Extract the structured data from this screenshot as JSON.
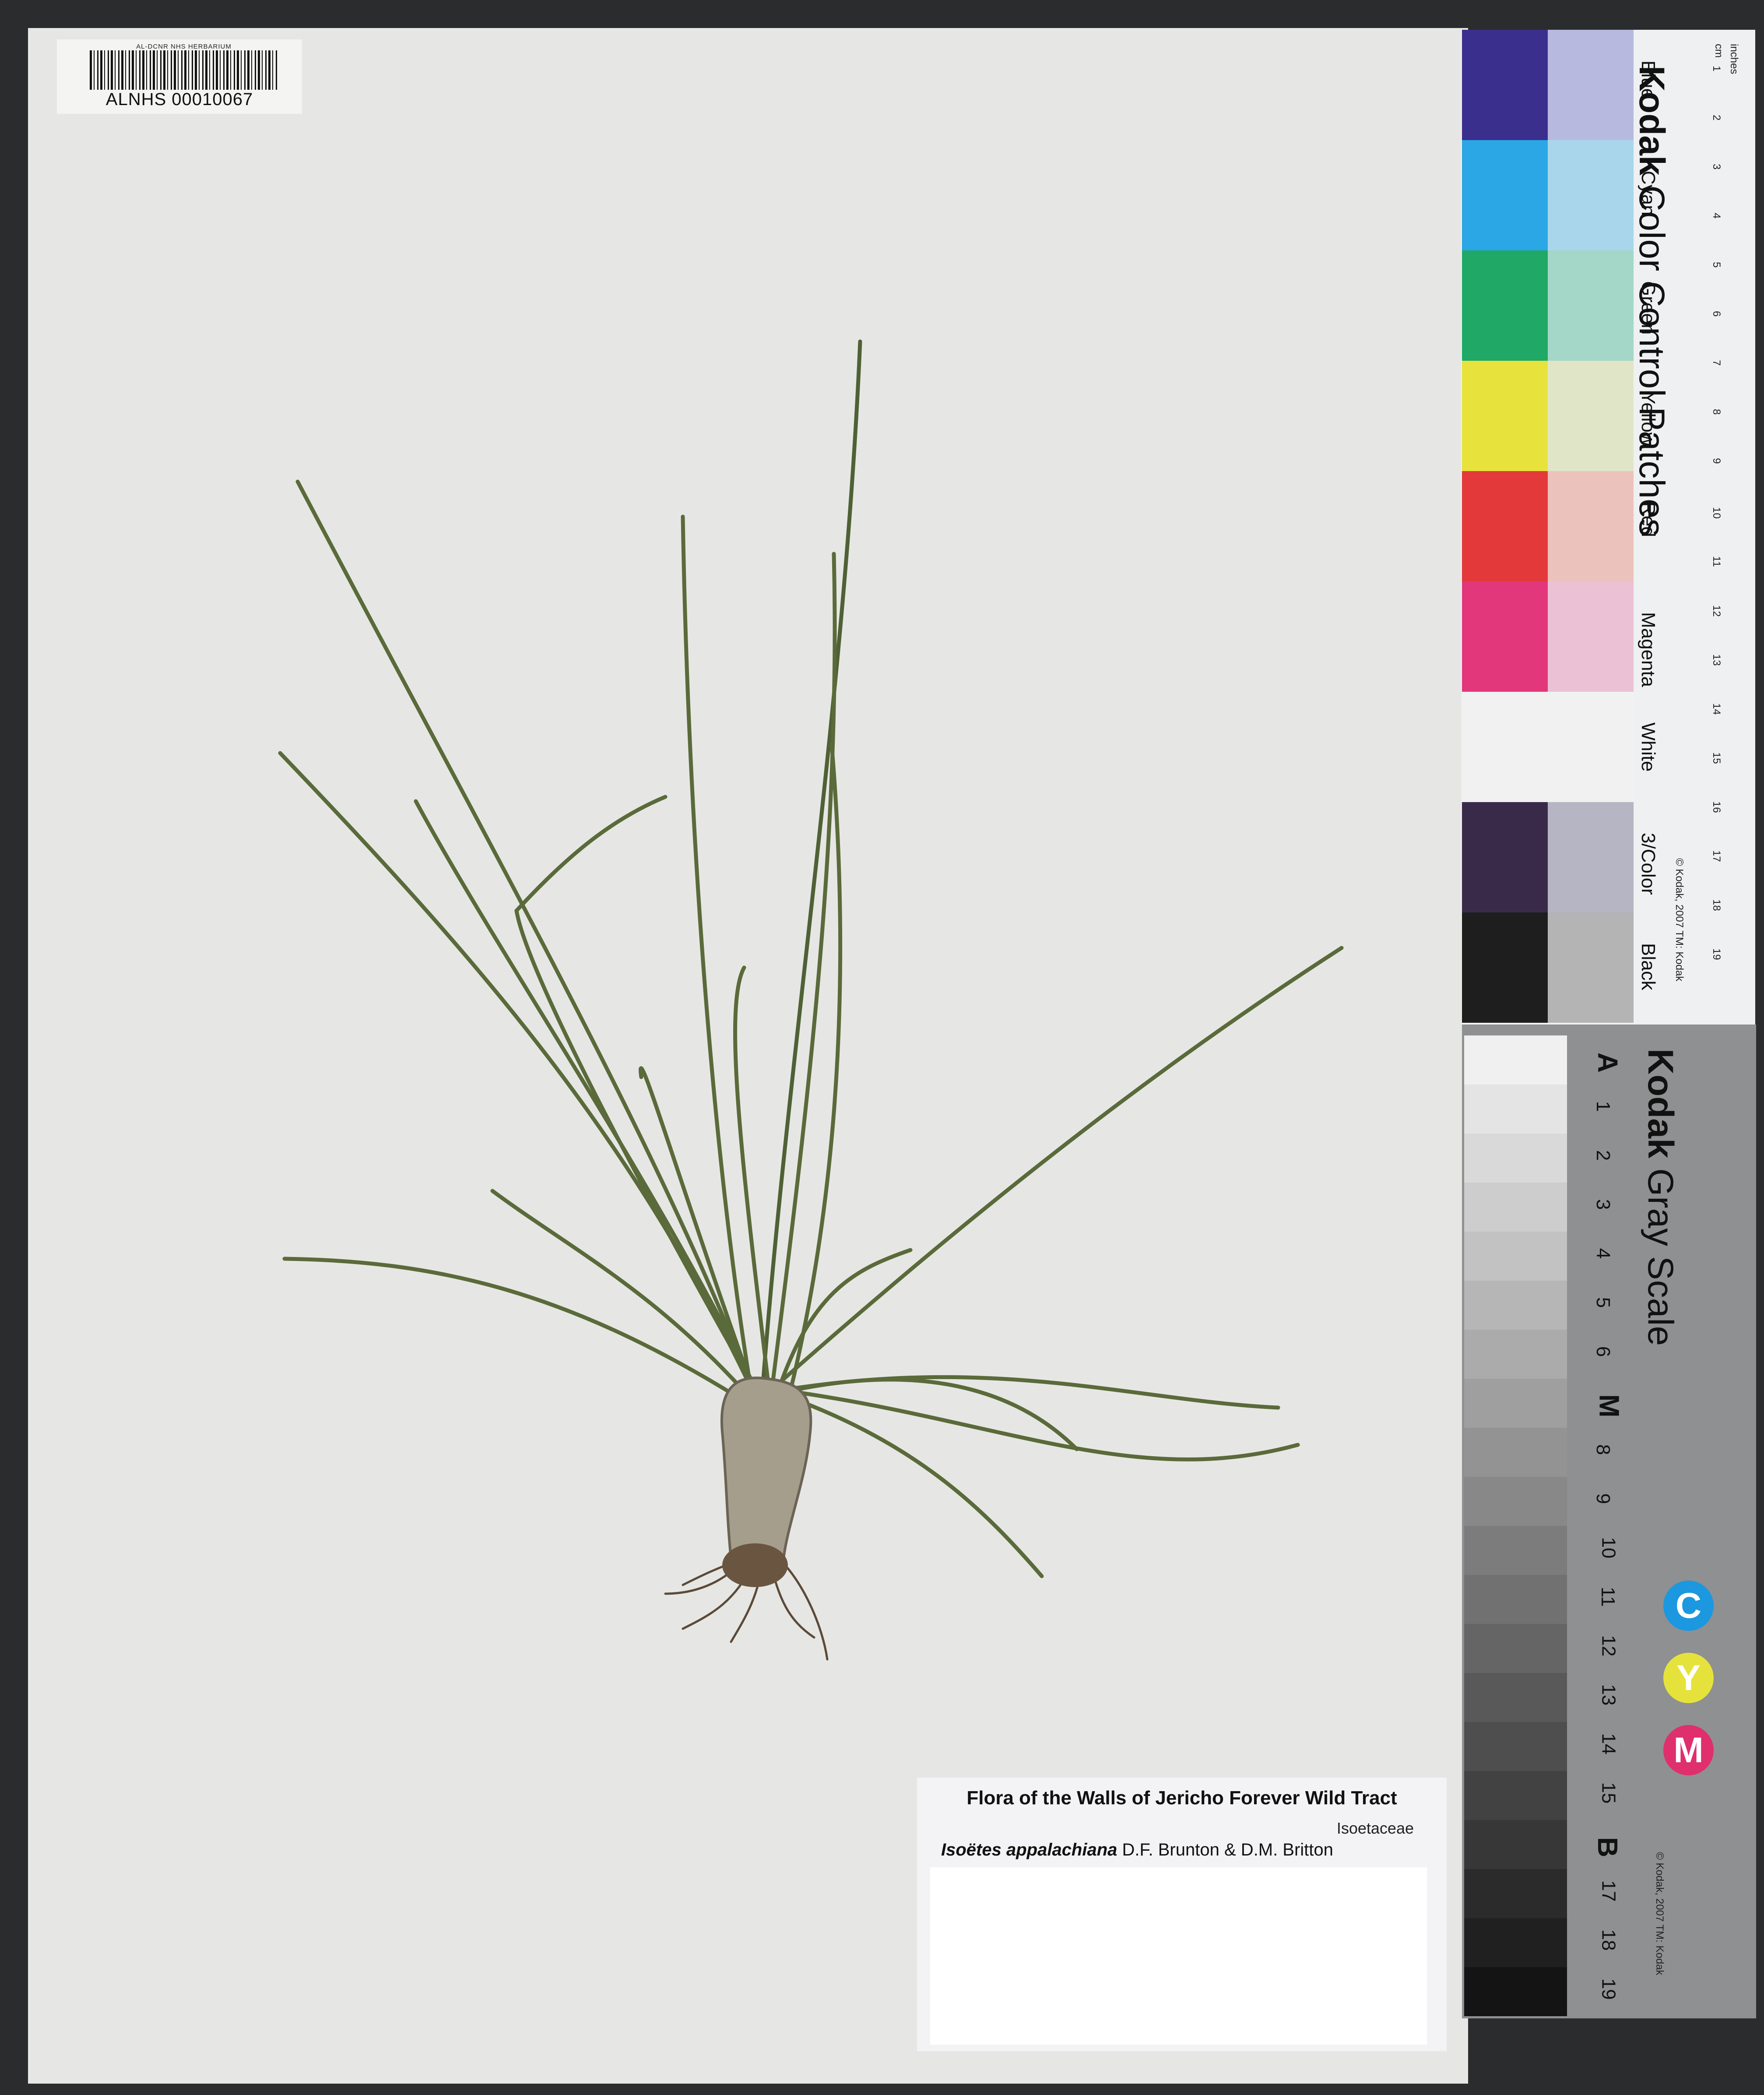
{
  "barcode": {
    "herbarium": "AL-DCNR NHS HERBARIUM",
    "catalog_number": "ALNHS 00010067"
  },
  "label": {
    "title": "Flora of the Walls of Jericho Forever Wild Tract",
    "family": "Isoetaceae",
    "genus_species": "Isoëtes appalachiana",
    "authors": " D.F. Brunton & D.M. Britton"
  },
  "color_card": {
    "brand": "Kodak",
    "title": "Color Control Patches",
    "copyright": "© Kodak, 2007 TM: Kodak",
    "units_cm": "cm",
    "units_in": "inches",
    "patches": [
      {
        "name": "Blue",
        "dark": "#3b2f8e",
        "light": "#b8b9df"
      },
      {
        "name": "Cyan",
        "dark": "#2aa7e4",
        "light": "#a9d6ea"
      },
      {
        "name": "Green",
        "dark": "#20a866",
        "light": "#a4d7c8"
      },
      {
        "name": "Yellow",
        "dark": "#e8e23d",
        "light": "#e1e5c8"
      },
      {
        "name": "Red",
        "dark": "#e3393a",
        "light": "#ecc2bc"
      },
      {
        "name": "Magenta",
        "dark": "#e2377a",
        "light": "#ebc1d5"
      },
      {
        "name": "White",
        "dark": "#f1f1f1",
        "light": "#f1f1f1"
      },
      {
        "name": "3/Color",
        "dark": "#3a2a4a",
        "light": "#b6b5c4"
      },
      {
        "name": "Black",
        "dark": "#1e1e1e",
        "light": "#b4b4b4"
      }
    ],
    "cm_ticks": [
      "1",
      "2",
      "3",
      "4",
      "5",
      "6",
      "7",
      "8",
      "9",
      "10",
      "11",
      "12",
      "13",
      "14",
      "15",
      "16",
      "17",
      "18",
      "19"
    ]
  },
  "gray_card": {
    "brand": "Kodak",
    "title": "Gray Scale",
    "copyright": "© Kodak, 2007 TM: Kodak",
    "steps": [
      "A",
      "1",
      "2",
      "3",
      "4",
      "5",
      "6",
      "M",
      "8",
      "9",
      "10",
      "11",
      "12",
      "13",
      "14",
      "15",
      "B",
      "17",
      "18",
      "19"
    ],
    "cym": [
      {
        "letter": "C",
        "color": "#1b98df"
      },
      {
        "letter": "Y",
        "color": "#e6e23c"
      },
      {
        "letter": "M",
        "color": "#df2f6d"
      }
    ]
  }
}
